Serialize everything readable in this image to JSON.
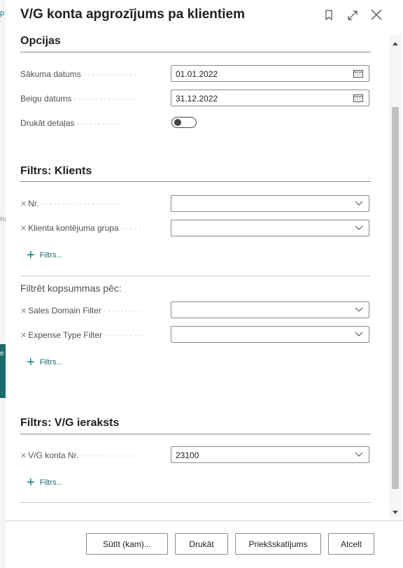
{
  "dialog": {
    "title": "V/G konta apgrozījums pa klientiem",
    "icons": [
      "bookmark-icon",
      "expand-icon",
      "close-icon"
    ]
  },
  "options": {
    "heading": "Opcijas",
    "start_date": {
      "label": "Sākuma datums",
      "value": "01.01.2022"
    },
    "end_date": {
      "label": "Beigu datums",
      "value": "31.12.2022"
    },
    "print_details": {
      "label": "Drukāt detaļas",
      "on": false
    }
  },
  "filter_customer": {
    "heading": "Filtrs: Klients",
    "fields": [
      {
        "label": "Nr.",
        "value": ""
      },
      {
        "label": "Klienta kontējuma grupa",
        "value": ""
      }
    ],
    "add_filter": "Filtrs..."
  },
  "filter_totals": {
    "heading": "Filtrēt kopsummas pēc:",
    "fields": [
      {
        "label": "Sales Domain Filter",
        "value": ""
      },
      {
        "label": "Expense Type Filter",
        "value": ""
      }
    ],
    "add_filter": "Filtrs..."
  },
  "filter_gl_entry": {
    "heading": "Filtrs: V/G ieraksts",
    "fields": [
      {
        "label": "V/G konta Nr.",
        "value": "23100"
      }
    ],
    "add_filter": "Filtrs..."
  },
  "buttons": {
    "send": "Sūtīt (kam)...",
    "print": "Drukāt",
    "preview": "Priekšskatījums",
    "cancel": "Atcelt"
  },
  "colors": {
    "accent": "#0f7b7b",
    "background_strip": "#1b6b6b"
  }
}
